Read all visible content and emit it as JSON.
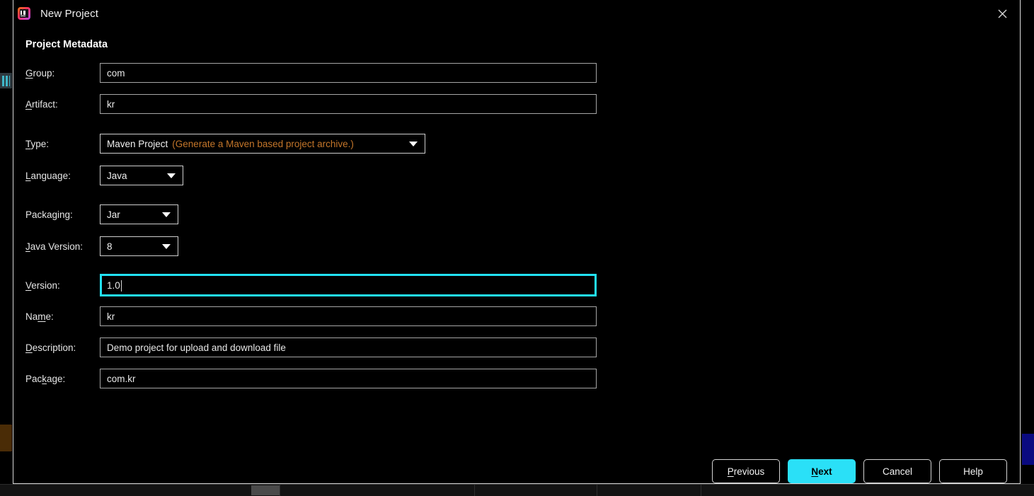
{
  "dialog": {
    "title": "New Project",
    "app_icon": "intellij-idea-icon",
    "close_icon": "close-icon",
    "section_heading": "Project Metadata"
  },
  "form": {
    "fields": [
      {
        "key": "group",
        "label_pre": "",
        "label_mn": "G",
        "label_post": "roup:",
        "kind": "text",
        "value": "com",
        "focused": false
      },
      {
        "key": "artifact",
        "label_pre": "",
        "label_mn": "A",
        "label_post": "rtifact:",
        "kind": "text",
        "value": "kr",
        "focused": false
      },
      {
        "key": "type",
        "label_pre": "",
        "label_mn": "T",
        "label_post": "ype:",
        "kind": "combo",
        "value": "Maven Project",
        "hint": "(Generate a Maven based project archive.)"
      },
      {
        "key": "language",
        "label_pre": "",
        "label_mn": "L",
        "label_post": "anguage:",
        "kind": "combo",
        "value": "Java",
        "hint": ""
      },
      {
        "key": "packaging",
        "label_pre": "Packa",
        "label_mn": "g",
        "label_post": "ing:",
        "kind": "combo",
        "value": "Jar",
        "hint": ""
      },
      {
        "key": "javaversion",
        "label_pre": "",
        "label_mn": "J",
        "label_post": "ava Version:",
        "kind": "combo",
        "value": "8",
        "hint": ""
      },
      {
        "key": "version",
        "label_pre": "",
        "label_mn": "V",
        "label_post": "ersion:",
        "kind": "text",
        "value": "1.0",
        "focused": true
      },
      {
        "key": "name",
        "label_pre": "Na",
        "label_mn": "m",
        "label_post": "e:",
        "kind": "text",
        "value": "kr",
        "focused": false
      },
      {
        "key": "description",
        "label_pre": "",
        "label_mn": "D",
        "label_post": "escription:",
        "kind": "text",
        "value": "Demo project for upload and download file",
        "focused": false
      },
      {
        "key": "package",
        "label_pre": "Pac",
        "label_mn": "k",
        "label_post": "age:",
        "kind": "text",
        "value": "com.kr",
        "focused": false
      }
    ]
  },
  "buttons": {
    "previous": {
      "pre": "",
      "mn": "P",
      "post": "revious"
    },
    "next": {
      "pre": "",
      "mn": "N",
      "post": "ext"
    },
    "cancel": {
      "pre": "Cancel",
      "mn": "",
      "post": ""
    },
    "help": {
      "pre": "Help",
      "mn": "",
      "post": ""
    }
  },
  "colors": {
    "accent_cyan": "#2ae0f7",
    "hint_orange": "#c4762a",
    "dialog_bg": "#000000",
    "field_border": "#a6a6a6"
  }
}
